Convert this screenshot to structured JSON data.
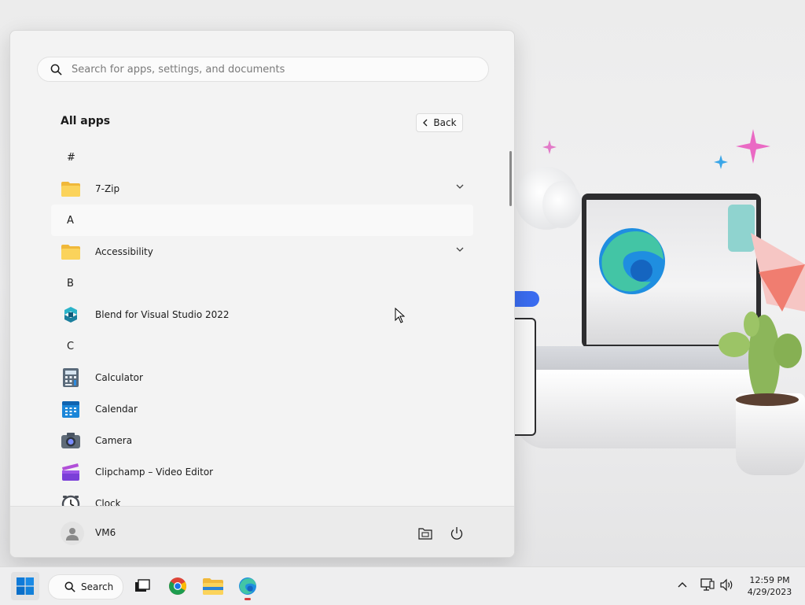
{
  "start_menu": {
    "search_placeholder": "Search for apps, settings, and documents",
    "title": "All apps",
    "back_label": "Back",
    "apps": [
      {
        "type": "letter",
        "text": "#"
      },
      {
        "type": "app",
        "label": "7-Zip",
        "icon": "folder-icon",
        "expandable": true
      },
      {
        "type": "letter",
        "text": "A"
      },
      {
        "type": "app",
        "label": "Accessibility",
        "icon": "folder-icon",
        "expandable": true
      },
      {
        "type": "letter",
        "text": "B"
      },
      {
        "type": "app",
        "label": "Blend for Visual Studio 2022",
        "icon": "blend-icon"
      },
      {
        "type": "letter",
        "text": "C"
      },
      {
        "type": "app",
        "label": "Calculator",
        "icon": "calculator-icon"
      },
      {
        "type": "app",
        "label": "Calendar",
        "icon": "calendar-icon"
      },
      {
        "type": "app",
        "label": "Camera",
        "icon": "camera-icon"
      },
      {
        "type": "app",
        "label": "Clipchamp – Video Editor",
        "icon": "clipchamp-icon"
      },
      {
        "type": "app",
        "label": "Clock",
        "icon": "clock-icon"
      }
    ],
    "user_name": "VM6"
  },
  "taskbar": {
    "search_label": "Search",
    "apps": [
      "task-view-icon",
      "chrome-icon",
      "file-explorer-icon",
      "edge-icon"
    ],
    "time": "12:59 PM",
    "date": "4/29/2023"
  },
  "colors": {
    "accent": "#0078d4",
    "folder": "#f8c53d"
  }
}
